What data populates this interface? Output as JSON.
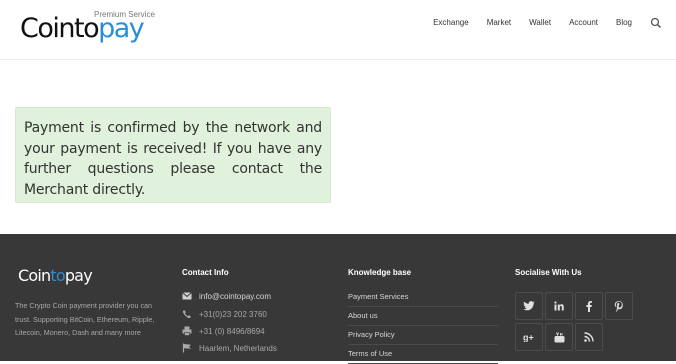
{
  "header": {
    "logo": {
      "text_before": "Cointo",
      "text_accent": "pay",
      "tagline": "Premium Service"
    },
    "nav": [
      "Exchange",
      "Market",
      "Wallet",
      "Account",
      "Blog"
    ]
  },
  "main": {
    "notice": "Payment is confirmed by the network and your payment is received! If you have any further questions please contact the Merchant directly."
  },
  "footer": {
    "logo": {
      "text_before": "Coin",
      "text_accent": "to",
      "text_after": "pay"
    },
    "about": "The Crypto Coin payment provider you can trust. Supporting BitCoin, Ethereum, Ripple, Litecoin, Monero, Dash and many more",
    "contact": {
      "heading": "Contact Info",
      "email": "info@cointopay.com",
      "phone": "+31(0)23 202 3760",
      "fax": "+31 (0) 8496/8694",
      "address": "Haarlem, Netherlands"
    },
    "knowledge": {
      "heading": "Knowledge base",
      "links": [
        "Payment Services",
        "About us",
        "Privacy Policy",
        "Terms of Use"
      ]
    },
    "social": {
      "heading": "Socialise With Us",
      "icons": [
        "twitter-icon",
        "linkedin-icon",
        "facebook-icon",
        "pinterest-icon",
        "googleplus-icon",
        "youtube-icon",
        "rss-icon"
      ]
    }
  },
  "colors": {
    "accent": "#2a8fd6",
    "footer_bg": "#383838",
    "notice_bg": "#e0f1dc"
  }
}
